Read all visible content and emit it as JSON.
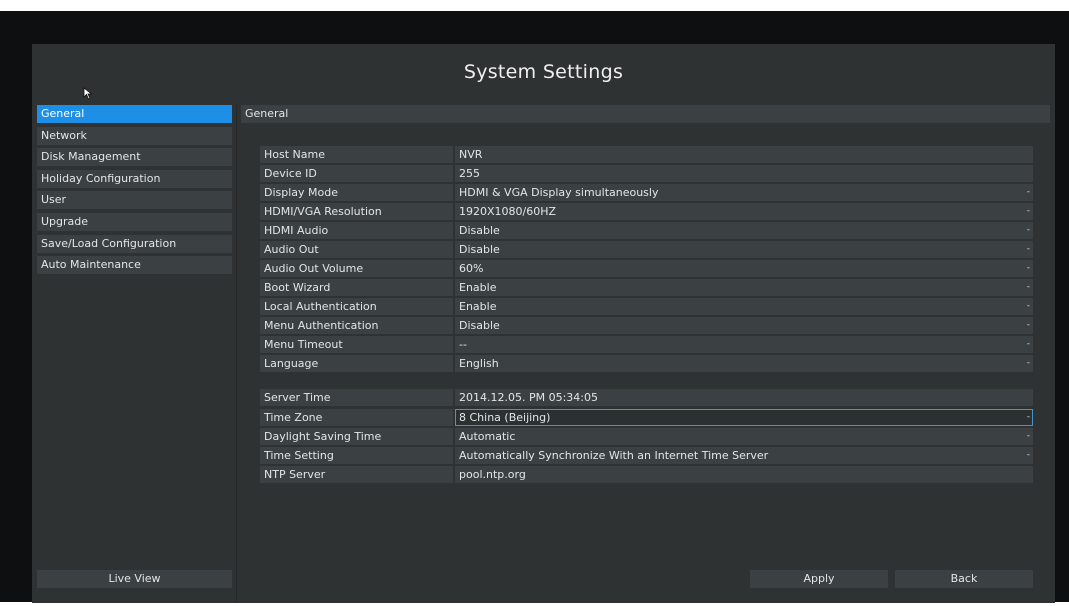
{
  "title": "System Settings",
  "sidebar": {
    "items": [
      {
        "label": "General"
      },
      {
        "label": "Network"
      },
      {
        "label": "Disk Management"
      },
      {
        "label": "Holiday Configuration"
      },
      {
        "label": "User"
      },
      {
        "label": "Upgrade"
      },
      {
        "label": "Save/Load Configuration"
      },
      {
        "label": "Auto Maintenance"
      }
    ],
    "active_item": "General",
    "live_view_label": "Live View"
  },
  "section_title": "General",
  "general": {
    "host_name": {
      "label": "Host Name",
      "value": "NVR"
    },
    "device_id": {
      "label": "Device ID",
      "value": "255"
    },
    "display_mode": {
      "label": "Display Mode",
      "value": "HDMI & VGA Display simultaneously"
    },
    "resolution": {
      "label": "HDMI/VGA Resolution",
      "value": "1920X1080/60HZ"
    },
    "hdmi_audio": {
      "label": "HDMI Audio",
      "value": "Disable"
    },
    "audio_out": {
      "label": "Audio Out",
      "value": "Disable"
    },
    "audio_out_volume": {
      "label": "Audio Out Volume",
      "value": "60%"
    },
    "boot_wizard": {
      "label": "Boot Wizard",
      "value": "Enable"
    },
    "local_auth": {
      "label": "Local Authentication",
      "value": "Enable"
    },
    "menu_auth": {
      "label": "Menu Authentication",
      "value": "Disable"
    },
    "menu_timeout": {
      "label": "Menu Timeout",
      "value": "--"
    },
    "language": {
      "label": "Language",
      "value": "English"
    }
  },
  "time": {
    "server_time": {
      "label": "Server Time",
      "value": "2014.12.05. PM 05:34:05"
    },
    "time_zone": {
      "label": "Time Zone",
      "value": "8 China (Beijing)"
    },
    "dst": {
      "label": "Daylight Saving Time",
      "value": "Automatic"
    },
    "time_setting": {
      "label": "Time Setting",
      "value": "Automatically Synchronize With an Internet Time Server"
    },
    "ntp_server": {
      "label": "NTP Server",
      "value": "pool.ntp.org"
    }
  },
  "buttons": {
    "apply": "Apply",
    "back": "Back"
  },
  "dropdown_glyph": "-",
  "colors": {
    "accent": "#1e8fe6",
    "panel": "#2e3233",
    "field": "#3b4142",
    "focus_border": "#4a93c9"
  }
}
